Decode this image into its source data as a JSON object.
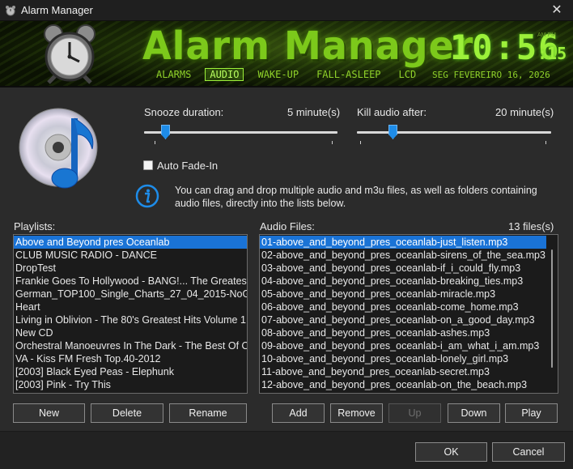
{
  "window": {
    "title": "Alarm Manager",
    "close_glyph": "✕"
  },
  "banner": {
    "brand": "Alarm Manager",
    "time_hm": "10:56",
    "time_sec": ":15",
    "ampm": "AM PM",
    "tabs": [
      {
        "label": "ALARMS",
        "active": false
      },
      {
        "label": "AUDIO",
        "active": true
      },
      {
        "label": "WAKE-UP",
        "active": false
      },
      {
        "label": "FALL-ASLEEP",
        "active": false
      },
      {
        "label": "LCD",
        "active": false
      }
    ],
    "date": "SEG FEVEREIRO 16, 2026",
    "accent_color": "#9cf03a"
  },
  "snooze": {
    "label": "Snooze duration:",
    "value": "5 minute(s)",
    "level": 0.09
  },
  "kill_audio": {
    "label": "Kill audio after:",
    "value": "20 minute(s)",
    "level": 0.17
  },
  "auto_fade": {
    "label": "Auto Fade-In",
    "checked": false
  },
  "info": {
    "icon": "info-icon",
    "text": "You can drag and drop multiple audio and m3u files, as well as folders containing audio files, directly into the lists below."
  },
  "playlists": {
    "label": "Playlists:",
    "items": [
      "Above and Beyond pres Oceanlab",
      "CLUB MUSIC RADIO - DANCE",
      "DropTest",
      "Frankie Goes To Hollywood - BANG!... The Greatest Hits",
      "German_TOP100_Single_Charts_27_04_2015-NoGroup",
      "Heart",
      "Living in Oblivion - The 80's Greatest Hits Volume 1",
      "New CD",
      "Orchestral Manoeuvres In The Dark - The Best Of OMD",
      "VA - Kiss FM Fresh Top.40-2012",
      "[2003] Black Eyed Peas - Elephunk",
      "[2003] Pink - Try This"
    ],
    "selected_index": 0,
    "buttons": [
      "New",
      "Delete",
      "Rename"
    ]
  },
  "audio_files": {
    "label": "Audio Files:",
    "count": "13 files(s)",
    "items": [
      "01-above_and_beyond_pres_oceanlab-just_listen.mp3",
      "02-above_and_beyond_pres_oceanlab-sirens_of_the_sea.mp3",
      "03-above_and_beyond_pres_oceanlab-if_i_could_fly.mp3",
      "04-above_and_beyond_pres_oceanlab-breaking_ties.mp3",
      "05-above_and_beyond_pres_oceanlab-miracle.mp3",
      "06-above_and_beyond_pres_oceanlab-come_home.mp3",
      "07-above_and_beyond_pres_oceanlab-on_a_good_day.mp3",
      "08-above_and_beyond_pres_oceanlab-ashes.mp3",
      "09-above_and_beyond_pres_oceanlab-i_am_what_i_am.mp3",
      "10-above_and_beyond_pres_oceanlab-lonely_girl.mp3",
      "11-above_and_beyond_pres_oceanlab-secret.mp3",
      "12-above_and_beyond_pres_oceanlab-on_the_beach.mp3"
    ],
    "selected_index": 0,
    "buttons": [
      {
        "label": "Add",
        "enabled": true
      },
      {
        "label": "Remove",
        "enabled": true
      },
      {
        "label": "Up",
        "enabled": false
      },
      {
        "label": "Down",
        "enabled": true
      },
      {
        "label": "Play",
        "enabled": true
      }
    ]
  },
  "footer": {
    "ok": "OK",
    "cancel": "Cancel"
  }
}
